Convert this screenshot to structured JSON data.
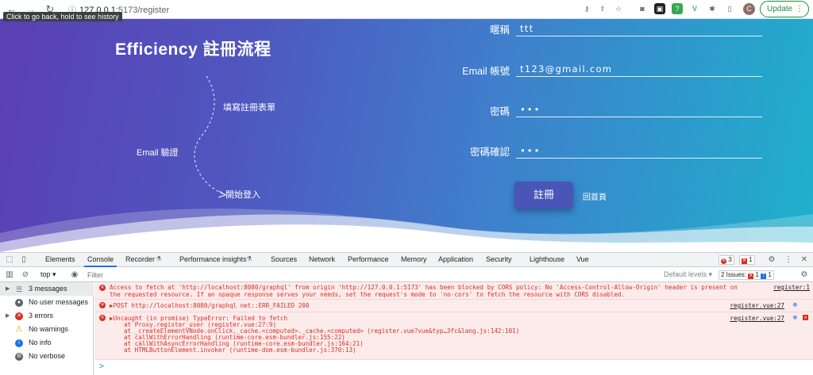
{
  "browser": {
    "url_host": "127.0.0.1",
    "url_path": ":5173/register",
    "tooltip": "Click to go back, hold to see history",
    "profile_initial": "C",
    "update_label": "Update"
  },
  "page": {
    "brand": "Efficiency 註冊流程",
    "steps": [
      "填寫註冊表單",
      "Email 驗證",
      "開始登入"
    ],
    "form": {
      "nickname_label": "暱稱",
      "nickname_value": "ttt",
      "email_label": "Email 帳號",
      "email_value": "t123@gmail.com",
      "password_label": "密碼",
      "password_value": "•••",
      "confirm_label": "密碼確認",
      "confirm_value": "•••",
      "submit_label": "註冊",
      "home_link": "回首頁"
    }
  },
  "devtools": {
    "tabs": [
      "Elements",
      "Console",
      "Recorder",
      "Performance insights",
      "Sources",
      "Network",
      "Performance",
      "Memory",
      "Application",
      "Security",
      "Lighthouse",
      "Vue"
    ],
    "active_tab": "Console",
    "error_count": "3",
    "issue_count": "1",
    "context": "top",
    "filter_placeholder": "Filter",
    "levels": "Default levels",
    "issues_label": "2 Issues:",
    "issues_red": "1",
    "issues_blue": "1",
    "sidebar": [
      {
        "label": "3 messages",
        "icon": "list-icon"
      },
      {
        "label": "No user messages",
        "icon": "user-icon"
      },
      {
        "label": "3 errors",
        "icon": "error-icon"
      },
      {
        "label": "No warnings",
        "icon": "warning-icon"
      },
      {
        "label": "No info",
        "icon": "info-icon"
      },
      {
        "label": "No verbose",
        "icon": "verbose-icon"
      }
    ],
    "messages": {
      "cors_line1": "Access to fetch at 'http://localhost:8080/graphql' from origin 'http://127.0.0.1:5173' has been blocked by CORS policy: No 'Access-Control-Allow-Origin' header is present on",
      "cors_src": "register:1",
      "cors_line2": "the requested resource. If an opaque response serves your needs, set the request's mode to 'no-cors' to fetch the resource with CORS disabled.",
      "post_line": "▶POST http://localhost:8080/graphql net::ERR_FAILED 200",
      "post_src": "register.vue:27",
      "uncaught_line": "▶Uncaught (in promise) TypeError: Failed to fetch",
      "uncaught_src": "register.vue:27",
      "stack": [
        "at Proxy.register_user (register.vue:27:9)",
        "at _createElementVNode.onClick._cache.<computed>._cache.<computed> (register.vue?vue&typ…3fc&lang.js:142:101)",
        "at callWithErrorHandling (runtime-core.esm-bundler.js:155:22)",
        "at callWithAsyncErrorHandling (runtime-core.esm-bundler.js:164:21)",
        "at HTMLButtonElement.invoker (runtime-dom.esm-bundler.js:370:13)"
      ]
    },
    "prompt": ">"
  },
  "colors": {
    "page_gradient_start": "#5b3fb5",
    "page_gradient_end": "#1fb0cc",
    "error_red": "#d93025",
    "devtools_accent": "#1a73e8"
  }
}
